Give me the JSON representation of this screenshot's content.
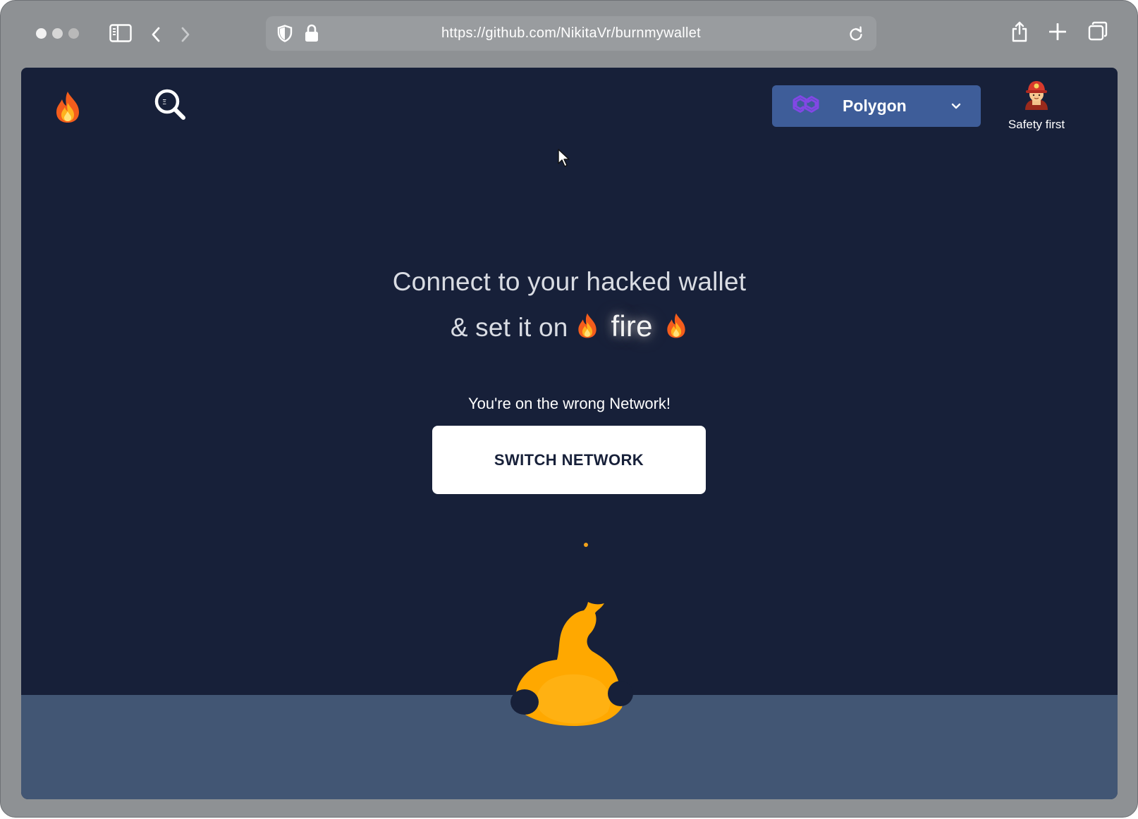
{
  "browser": {
    "url": "https://github.com/NikitaVr/burnmywallet",
    "icons": [
      "sidebar-icon",
      "back-icon",
      "forward-icon",
      "shield-icon",
      "lock-icon",
      "reload-icon",
      "share-icon",
      "new-tab-icon",
      "tabs-overview-icon"
    ]
  },
  "header": {
    "network": {
      "selected": "Polygon",
      "icon": "polygon-icon"
    },
    "safety": {
      "label": "Safety first",
      "icon": "firefighter-icon"
    }
  },
  "hero": {
    "line1": "Connect to your hacked wallet",
    "line2_prefix": "& set it on",
    "fire_word": "fire"
  },
  "status": {
    "message": "You're on the wrong Network!"
  },
  "actions": {
    "switch_network": "SWITCH NETWORK"
  },
  "colors": {
    "background": "#172039",
    "ground": "#425674",
    "network_button": "#3e5d99",
    "polygon": "#8247e5",
    "flame": "#ffa800"
  }
}
